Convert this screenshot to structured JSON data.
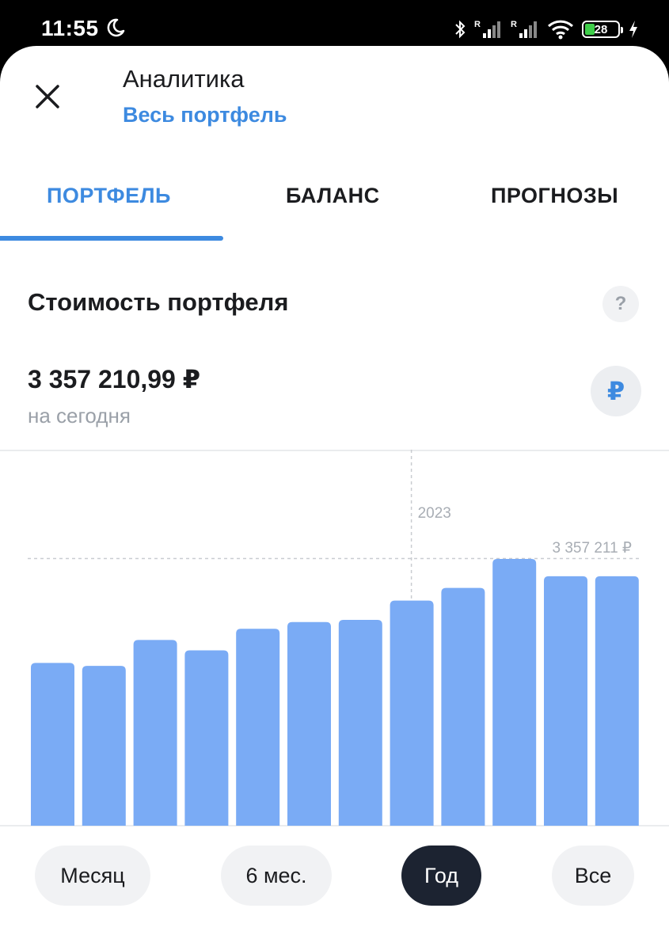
{
  "status_bar": {
    "time": "11:55",
    "battery": "28"
  },
  "header": {
    "title": "Аналитика",
    "subtitle": "Весь портфель"
  },
  "tabs": [
    {
      "label": "ПОРТФЕЛЬ",
      "active": true
    },
    {
      "label": "БАЛАНС",
      "active": false
    },
    {
      "label": "ПРОГНОЗЫ",
      "active": false
    }
  ],
  "section": {
    "title": "Стоимость портфеля",
    "help": "?",
    "value": "3 357 210,99 ₽",
    "caption": "на сегодня",
    "currency_symbol": "₽"
  },
  "chart_data": {
    "type": "bar",
    "values": [
      2190000,
      2150000,
      2500000,
      2360000,
      2650000,
      2740000,
      2770000,
      3030000,
      3200000,
      3590000,
      3357211,
      3357211
    ],
    "year_marker": "2023",
    "max_label": "3 357 211 ₽",
    "colors": {
      "bar": "#7aabf5",
      "grid": "#c9ccd1"
    }
  },
  "periods": [
    {
      "label": "Месяц",
      "selected": false
    },
    {
      "label": "6 мес.",
      "selected": false
    },
    {
      "label": "Год",
      "selected": true
    },
    {
      "label": "Все",
      "selected": false
    }
  ],
  "colors": {
    "accent": "#3d8ae0",
    "dark": "#1c2331"
  }
}
